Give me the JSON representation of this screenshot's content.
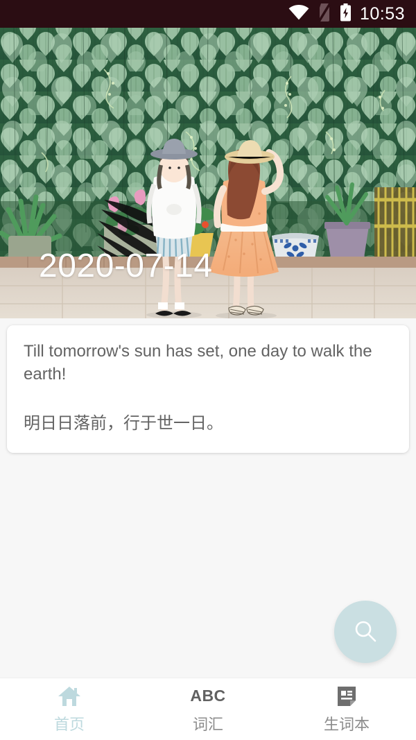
{
  "status_bar": {
    "time": "10:53",
    "icons": [
      "wifi-icon",
      "no-sim-icon",
      "battery-charging-icon"
    ],
    "background_color": "#2b0d13"
  },
  "hero": {
    "date_label": "2020-07-14",
    "alt": "illustration of two girls standing before a wall of heart-shaped green leaves with potted plants",
    "date_color": "#ffffff"
  },
  "quote_card": {
    "english": "Till tomorrow's sun has set, one day to walk the earth!",
    "chinese": "明日日落前，行于世一日。",
    "text_color": "#636363",
    "background_color": "#ffffff"
  },
  "fab": {
    "icon": "search-icon",
    "color": "#cadfe2",
    "icon_color": "#ffffff"
  },
  "bottom_nav": {
    "active_color": "#bdd9de",
    "inactive_color": "#8c8c8c",
    "items": [
      {
        "label": "首页",
        "icon": "home-icon",
        "active": true
      },
      {
        "label": "词汇",
        "icon": "abc-icon",
        "active": false
      },
      {
        "label": "生词本",
        "icon": "note-book-icon",
        "active": false
      }
    ]
  }
}
